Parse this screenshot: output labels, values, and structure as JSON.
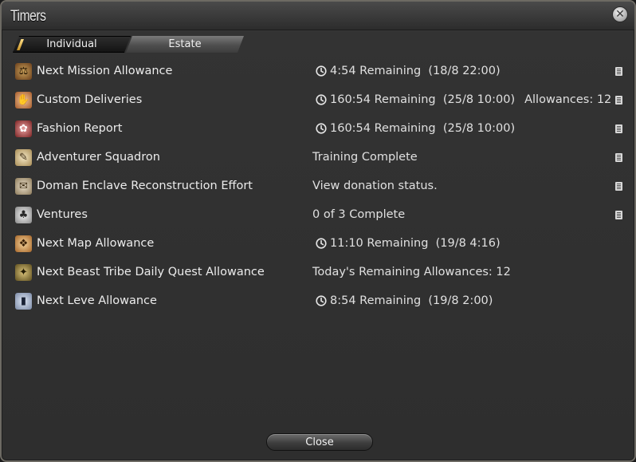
{
  "window": {
    "title": "Timers"
  },
  "tabs": [
    {
      "label": "Individual",
      "active": true
    },
    {
      "label": "Estate",
      "active": false
    }
  ],
  "rows": [
    {
      "icon": "scales-icon",
      "glyph": "⚖",
      "label": "Next Mission Allowance",
      "clock": true,
      "status": "4:54 Remaining  (18/8 22:00)",
      "extra": "",
      "doc": true
    },
    {
      "icon": "delivery-hand-icon",
      "glyph": "✋",
      "label": "Custom Deliveries",
      "clock": true,
      "status": "160:54 Remaining  (25/8 10:00)",
      "extra": "Allowances: 12",
      "doc": true
    },
    {
      "icon": "rose-icon",
      "glyph": "✿",
      "label": "Fashion Report",
      "clock": true,
      "status": "160:54 Remaining  (25/8 10:00)",
      "extra": "",
      "doc": true
    },
    {
      "icon": "scroll-icon",
      "glyph": "✎",
      "label": "Adventurer Squadron",
      "clock": false,
      "status": "Training Complete",
      "extra": "",
      "doc": true
    },
    {
      "icon": "doman-scroll-icon",
      "glyph": "✉",
      "label": "Doman Enclave Reconstruction Effort",
      "clock": false,
      "status": "View donation status.",
      "extra": "",
      "doc": true
    },
    {
      "icon": "bell-icon",
      "glyph": "♣",
      "label": "Ventures",
      "clock": false,
      "status": "0 of 3 Complete",
      "extra": "",
      "doc": true
    },
    {
      "icon": "treasure-map-icon",
      "glyph": "❖",
      "label": "Next Map Allowance",
      "clock": true,
      "status": "11:10 Remaining  (19/8 4:16)",
      "extra": "",
      "doc": false
    },
    {
      "icon": "beast-tribe-icon",
      "glyph": "✦",
      "label": "Next Beast Tribe Daily Quest Allowance",
      "clock": false,
      "status": "Today's Remaining Allowances: 12",
      "extra": "",
      "doc": false
    },
    {
      "icon": "leve-card-icon",
      "glyph": "▮",
      "label": "Next Leve Allowance",
      "clock": true,
      "status": "8:54 Remaining  (19/8 2:00)",
      "extra": "",
      "doc": false
    }
  ],
  "footer": {
    "close_label": "Close"
  }
}
